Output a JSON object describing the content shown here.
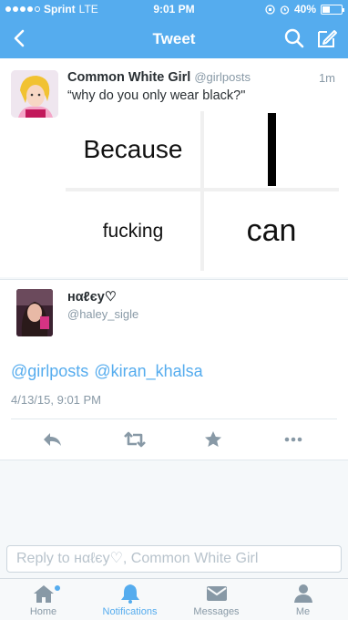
{
  "status_bar": {
    "carrier": "Sprint",
    "network": "LTE",
    "time": "9:01 PM",
    "battery": "40%",
    "battery_level": 0.4
  },
  "nav": {
    "title": "Tweet",
    "back_icon": "chevron-left-icon",
    "search_icon": "search-icon",
    "compose_icon": "compose-icon"
  },
  "quoted_tweet": {
    "name": "Common White Girl",
    "handle": "@girlposts",
    "time": "1m",
    "text": "“why do you only wear black?\"",
    "meme": {
      "cell1": "Because",
      "cell2": "I",
      "cell3": "fucking",
      "cell4": "can"
    }
  },
  "tweet": {
    "name": "нαℓєу♡",
    "handle": "@haley_sigle",
    "mentions": [
      "@girlposts",
      "@kiran_khalsa"
    ],
    "date": "4/13/15, 9:01 PM"
  },
  "reply": {
    "placeholder": "Reply to нαℓєу♡, Common White Girl"
  },
  "tabs": [
    {
      "label": "Home",
      "icon": "home-icon"
    },
    {
      "label": "Notifications",
      "icon": "bell-icon"
    },
    {
      "label": "Messages",
      "icon": "envelope-icon"
    },
    {
      "label": "Me",
      "icon": "person-icon"
    }
  ],
  "colors": {
    "accent": "#55acee",
    "text": "#292f33",
    "muted": "#8899a6"
  }
}
